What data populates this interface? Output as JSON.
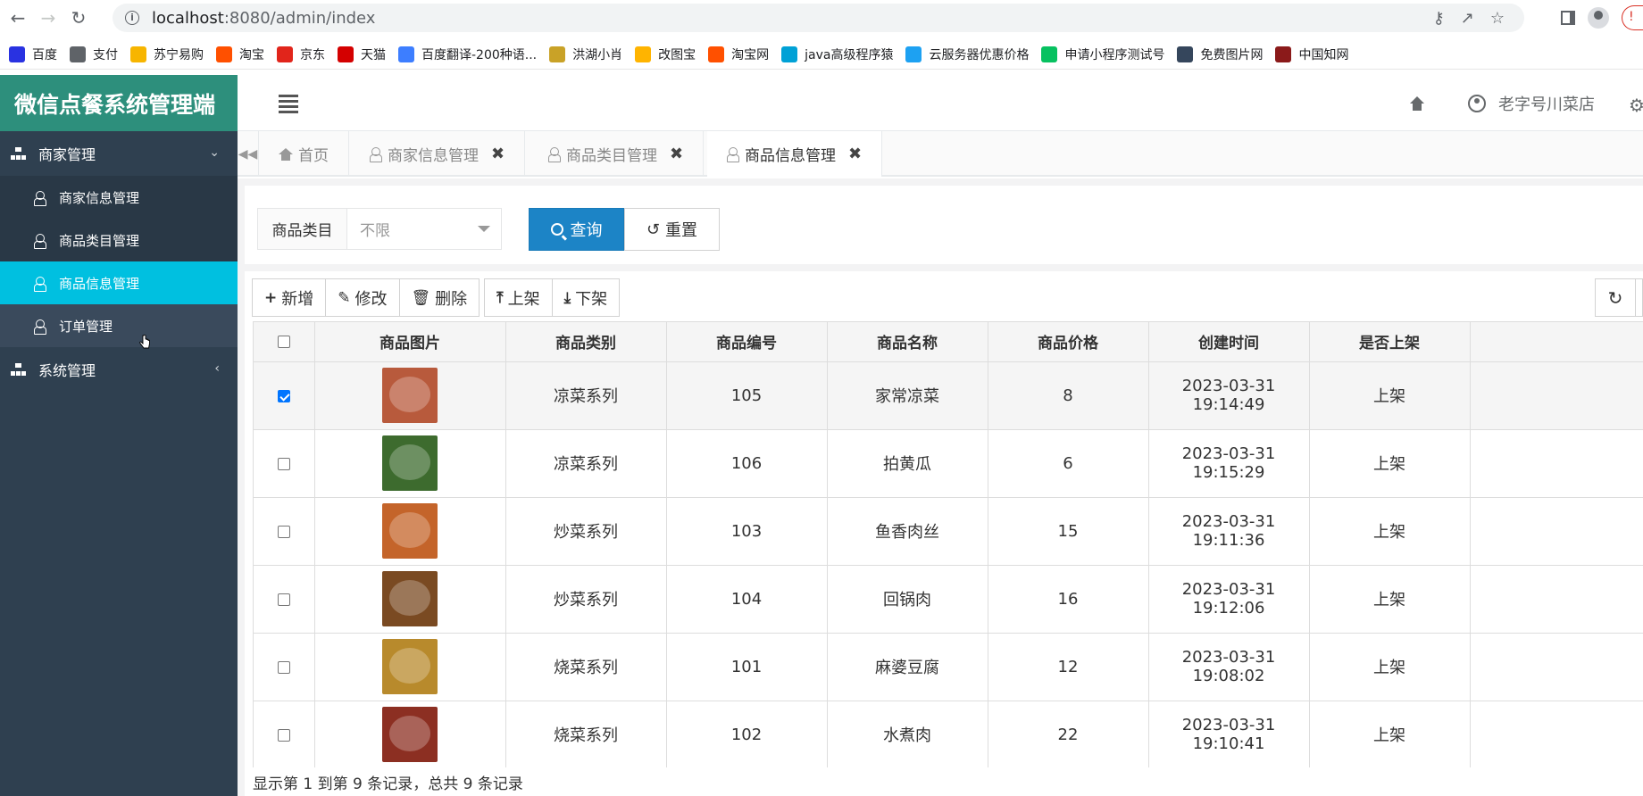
{
  "browser": {
    "url_host": "localhost",
    "url_rest": ":8080/admin/index",
    "bookmarks": [
      {
        "label": "百度",
        "icon": "baidu-icon",
        "color": "#2932e1"
      },
      {
        "label": "支付",
        "icon": "globe-icon",
        "color": "#5f6368"
      },
      {
        "label": "苏宁易购",
        "icon": "suning-icon",
        "color": "#f7b500"
      },
      {
        "label": "淘宝",
        "icon": "taobao-icon",
        "color": "#ff5000"
      },
      {
        "label": "京东",
        "icon": "jd-icon",
        "color": "#e1251b"
      },
      {
        "label": "天猫",
        "icon": "tmall-icon",
        "color": "#d40000"
      },
      {
        "label": "百度翻译-200种语...",
        "icon": "translate-icon",
        "color": "#3d7eff"
      },
      {
        "label": "洪湖小肖",
        "icon": "bird-icon",
        "color": "#c9a227"
      },
      {
        "label": "改图宝",
        "icon": "gaitubao-icon",
        "color": "#ffb400"
      },
      {
        "label": "淘宝网",
        "icon": "taobao-icon",
        "color": "#ff5000"
      },
      {
        "label": "java高级程序猿",
        "icon": "bilibili-icon",
        "color": "#00a1d6"
      },
      {
        "label": "云服务器优惠价格",
        "icon": "cloud-icon",
        "color": "#1da1f2"
      },
      {
        "label": "申请小程序测试号",
        "icon": "wechat-icon",
        "color": "#07c160"
      },
      {
        "label": "免费图片网",
        "icon": "tumblr-icon",
        "color": "#35465c"
      },
      {
        "label": "中国知网",
        "icon": "cnki-icon",
        "color": "#8b1a1a"
      }
    ]
  },
  "sidebar": {
    "title": "微信点餐系统管理端",
    "groups": [
      {
        "label": "商家管理",
        "expanded": true,
        "items": [
          {
            "label": "商家信息管理"
          },
          {
            "label": "商品类目管理"
          },
          {
            "label": "商品信息管理"
          },
          {
            "label": "订单管理"
          }
        ]
      },
      {
        "label": "系统管理",
        "expanded": false
      }
    ]
  },
  "header": {
    "username": "老字号川菜店"
  },
  "tabs": [
    {
      "label": "首页"
    },
    {
      "label": "商家信息管理"
    },
    {
      "label": "商品类目管理"
    },
    {
      "label": "商品信息管理"
    }
  ],
  "search": {
    "category_label": "商品类目",
    "category_value": "不限",
    "query_label": "查询",
    "reset_label": "重置"
  },
  "toolbar": {
    "add": "新增",
    "edit": "修改",
    "delete": "删除",
    "shelve": "上架",
    "unshelve": "下架"
  },
  "table": {
    "columns": [
      "商品图片",
      "商品类别",
      "商品编号",
      "商品名称",
      "商品价格",
      "创建时间",
      "是否上架"
    ],
    "rows": [
      {
        "checked": true,
        "category": "凉菜系列",
        "id": "105",
        "name": "家常凉菜",
        "price": "8",
        "created": "2023-03-31 19:14:49",
        "status": "上架",
        "thumb": "#b85a3c"
      },
      {
        "checked": false,
        "category": "凉菜系列",
        "id": "106",
        "name": "拍黄瓜",
        "price": "6",
        "created": "2023-03-31 19:15:29",
        "status": "上架",
        "thumb": "#3d6b2e"
      },
      {
        "checked": false,
        "category": "炒菜系列",
        "id": "103",
        "name": "鱼香肉丝",
        "price": "15",
        "created": "2023-03-31 19:11:36",
        "status": "上架",
        "thumb": "#c4642a"
      },
      {
        "checked": false,
        "category": "炒菜系列",
        "id": "104",
        "name": "回锅肉",
        "price": "16",
        "created": "2023-03-31 19:12:06",
        "status": "上架",
        "thumb": "#7a4a22"
      },
      {
        "checked": false,
        "category": "烧菜系列",
        "id": "101",
        "name": "麻婆豆腐",
        "price": "12",
        "created": "2023-03-31 19:08:02",
        "status": "上架",
        "thumb": "#b88a2c"
      },
      {
        "checked": false,
        "category": "烧菜系列",
        "id": "102",
        "name": "水煮肉",
        "price": "22",
        "created": "2023-03-31 19:10:41",
        "status": "上架",
        "thumb": "#8c2f22"
      }
    ]
  },
  "footer": {
    "info": "显示第 1 到第 9 条记录，总共 9 条记录"
  }
}
